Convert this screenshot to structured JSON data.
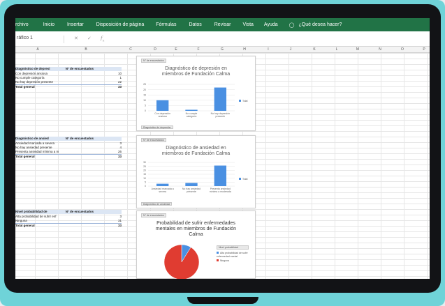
{
  "ribbon": {
    "tabs": [
      "rchivo",
      "Inicio",
      "Insertar",
      "Disposición de página",
      "Fórmulas",
      "Datos",
      "Revisar",
      "Vista",
      "Ayuda"
    ],
    "tell_me": "¿Qué desea hacer?",
    "tell_me_icon": "lightbulb-icon"
  },
  "formula_bar": {
    "name_box": "ráfico 1",
    "icons": [
      "cancel-icon",
      "enter-icon",
      "function-icon"
    ]
  },
  "columns": [
    "A",
    "B",
    "C",
    "D",
    "E",
    "F",
    "G",
    "H",
    "I",
    "J",
    "K",
    "L",
    "M",
    "N",
    "O",
    "P"
  ],
  "pivots": [
    {
      "header": [
        "Diagnóstico de depresi",
        "N° de encuestados"
      ],
      "rows": [
        [
          "Con depresión ansiosa",
          "10"
        ],
        [
          "No cumple categoría",
          "1"
        ],
        [
          "No hay depresión presente",
          "22"
        ]
      ],
      "total": [
        "Total general",
        "33"
      ]
    },
    {
      "header": [
        "Diagnóstico de ansied",
        "N° de encuestados"
      ],
      "rows": [
        [
          "Ansiedad marcada a severa",
          "3"
        ],
        [
          "No hay ansiedad presente",
          "4"
        ],
        [
          "Presenta ansiedad mínima a m",
          "26"
        ]
      ],
      "total": [
        "Total general",
        "33"
      ]
    },
    {
      "header": [
        "Nivel probabilidad de",
        "N° de encuestados"
      ],
      "rows": [
        [
          "Alta probabilidad de sufrir enf",
          "3"
        ],
        [
          "Ninguna",
          "31"
        ]
      ],
      "total": [
        "Total general",
        "33"
      ]
    }
  ],
  "charts": {
    "depresion": {
      "field_button": "N° de encuestados",
      "field_button2": "Diagnóstico de depresión",
      "title": "Diagnóstico de depresión en miembros de Fundación Calma",
      "legend": "Total",
      "color": "#4a90e2",
      "chart_data": {
        "type": "bar",
        "title": "Diagnóstico de depresión en miembros de Fundación Calma",
        "categories": [
          "Con depresión ansiosa",
          "No cumple categoría",
          "No hay depresión presente"
        ],
        "series": [
          {
            "name": "Total",
            "values": [
              10,
              1,
              22
            ]
          }
        ],
        "ylim": [
          0,
          25
        ],
        "yticks": [
          "0",
          "5",
          "10",
          "15",
          "20",
          "25"
        ]
      }
    },
    "ansiedad": {
      "field_button": "N° de encuestados",
      "field_button2": "Diagnóstico de ansiedad",
      "title": "Diagnóstico de ansiedad en miembros de Fundación Calma",
      "legend": "Total",
      "color": "#4a90e2",
      "chart_data": {
        "type": "bar",
        "title": "Diagnóstico de ansiedad en miembros de Fundación Calma",
        "categories": [
          "Ansiedad marcada a severa",
          "No hay ansiedad presente",
          "Presenta ansiedad mínima a moderada"
        ],
        "series": [
          {
            "name": "Total",
            "values": [
              3,
              4,
              26
            ]
          }
        ],
        "ylim": [
          0,
          30
        ],
        "yticks": [
          "0",
          "5",
          "10",
          "15",
          "20",
          "25",
          "30"
        ]
      }
    },
    "probabilidad": {
      "field_button": "N° de encuestados",
      "field_button2": "Nivel probabilidad",
      "title": "Probabilidad de sufrir enfermedades mentales en miembros de Fundación Calma",
      "legend": [
        "Alta probabilidad de sufrir enfermedad mental",
        "Ninguna"
      ],
      "colors": [
        "#4a90e2",
        "#e03c31"
      ],
      "chart_data": {
        "type": "pie",
        "title": "Probabilidad de sufrir enfermedades mentales en miembros de Fundación Calma",
        "categories": [
          "Alta probabilidad de sufrir enfermedad mental",
          "Ninguna"
        ],
        "values": [
          3,
          31
        ]
      }
    }
  }
}
